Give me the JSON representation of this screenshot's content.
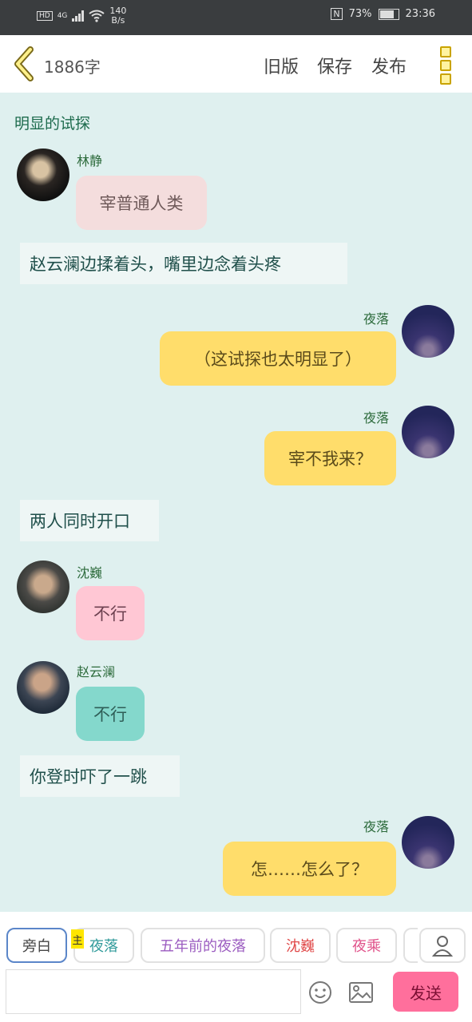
{
  "status_bar": {
    "hd": "HD",
    "network": "4G",
    "speed_value": "140",
    "speed_unit": "B/s",
    "nfc": "N",
    "battery": "73%",
    "time": "23:36"
  },
  "toolbar": {
    "word_count": "1886字",
    "old_version": "旧版",
    "save": "保存",
    "publish": "发布"
  },
  "chat": {
    "scene_title": "明显的试探",
    "messages": [
      {
        "name": "林静",
        "text": "宰普通人类"
      },
      {
        "text": "赵云澜边揉着头，嘴里边念着头疼"
      },
      {
        "name": "夜落",
        "text": "（这试探也太明显了）"
      },
      {
        "name": "夜落",
        "text": "宰不我来？"
      },
      {
        "text": "两人同时开口"
      },
      {
        "name": "沈巍",
        "text": "不行"
      },
      {
        "name": "赵云澜",
        "text": "不行"
      },
      {
        "text": "你登时吓了一跳"
      },
      {
        "name": "夜落",
        "text": "怎……怎么了？"
      }
    ]
  },
  "bottom": {
    "roles": [
      "旁白",
      "夜落",
      "五年前的夜落",
      "沈巍",
      "夜乘"
    ],
    "main_tag": "主",
    "input_value": "",
    "send": "发送"
  },
  "colors": {
    "accent_yellow": "#ffdd6b",
    "pink_light": "#f4dddd",
    "pink": "#ffc7d4",
    "teal": "#84d8cc",
    "send": "#ff6f9c"
  }
}
